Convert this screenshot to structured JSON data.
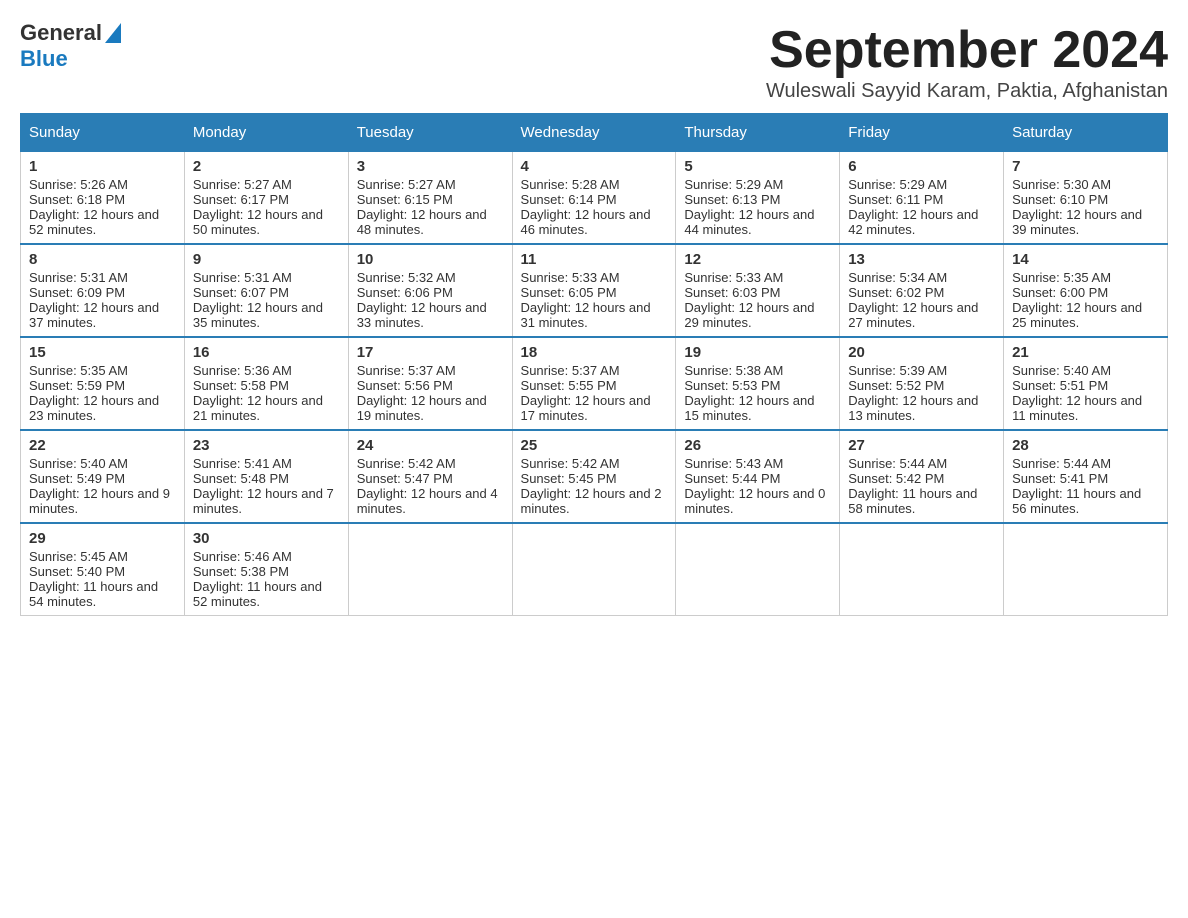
{
  "header": {
    "logo_general": "General",
    "logo_blue": "Blue",
    "month_title": "September 2024",
    "subtitle": "Wuleswali Sayyid Karam, Paktia, Afghanistan"
  },
  "days_of_week": [
    "Sunday",
    "Monday",
    "Tuesday",
    "Wednesday",
    "Thursday",
    "Friday",
    "Saturday"
  ],
  "weeks": [
    [
      {
        "day": "1",
        "sunrise": "Sunrise: 5:26 AM",
        "sunset": "Sunset: 6:18 PM",
        "daylight": "Daylight: 12 hours and 52 minutes."
      },
      {
        "day": "2",
        "sunrise": "Sunrise: 5:27 AM",
        "sunset": "Sunset: 6:17 PM",
        "daylight": "Daylight: 12 hours and 50 minutes."
      },
      {
        "day": "3",
        "sunrise": "Sunrise: 5:27 AM",
        "sunset": "Sunset: 6:15 PM",
        "daylight": "Daylight: 12 hours and 48 minutes."
      },
      {
        "day": "4",
        "sunrise": "Sunrise: 5:28 AM",
        "sunset": "Sunset: 6:14 PM",
        "daylight": "Daylight: 12 hours and 46 minutes."
      },
      {
        "day": "5",
        "sunrise": "Sunrise: 5:29 AM",
        "sunset": "Sunset: 6:13 PM",
        "daylight": "Daylight: 12 hours and 44 minutes."
      },
      {
        "day": "6",
        "sunrise": "Sunrise: 5:29 AM",
        "sunset": "Sunset: 6:11 PM",
        "daylight": "Daylight: 12 hours and 42 minutes."
      },
      {
        "day": "7",
        "sunrise": "Sunrise: 5:30 AM",
        "sunset": "Sunset: 6:10 PM",
        "daylight": "Daylight: 12 hours and 39 minutes."
      }
    ],
    [
      {
        "day": "8",
        "sunrise": "Sunrise: 5:31 AM",
        "sunset": "Sunset: 6:09 PM",
        "daylight": "Daylight: 12 hours and 37 minutes."
      },
      {
        "day": "9",
        "sunrise": "Sunrise: 5:31 AM",
        "sunset": "Sunset: 6:07 PM",
        "daylight": "Daylight: 12 hours and 35 minutes."
      },
      {
        "day": "10",
        "sunrise": "Sunrise: 5:32 AM",
        "sunset": "Sunset: 6:06 PM",
        "daylight": "Daylight: 12 hours and 33 minutes."
      },
      {
        "day": "11",
        "sunrise": "Sunrise: 5:33 AM",
        "sunset": "Sunset: 6:05 PM",
        "daylight": "Daylight: 12 hours and 31 minutes."
      },
      {
        "day": "12",
        "sunrise": "Sunrise: 5:33 AM",
        "sunset": "Sunset: 6:03 PM",
        "daylight": "Daylight: 12 hours and 29 minutes."
      },
      {
        "day": "13",
        "sunrise": "Sunrise: 5:34 AM",
        "sunset": "Sunset: 6:02 PM",
        "daylight": "Daylight: 12 hours and 27 minutes."
      },
      {
        "day": "14",
        "sunrise": "Sunrise: 5:35 AM",
        "sunset": "Sunset: 6:00 PM",
        "daylight": "Daylight: 12 hours and 25 minutes."
      }
    ],
    [
      {
        "day": "15",
        "sunrise": "Sunrise: 5:35 AM",
        "sunset": "Sunset: 5:59 PM",
        "daylight": "Daylight: 12 hours and 23 minutes."
      },
      {
        "day": "16",
        "sunrise": "Sunrise: 5:36 AM",
        "sunset": "Sunset: 5:58 PM",
        "daylight": "Daylight: 12 hours and 21 minutes."
      },
      {
        "day": "17",
        "sunrise": "Sunrise: 5:37 AM",
        "sunset": "Sunset: 5:56 PM",
        "daylight": "Daylight: 12 hours and 19 minutes."
      },
      {
        "day": "18",
        "sunrise": "Sunrise: 5:37 AM",
        "sunset": "Sunset: 5:55 PM",
        "daylight": "Daylight: 12 hours and 17 minutes."
      },
      {
        "day": "19",
        "sunrise": "Sunrise: 5:38 AM",
        "sunset": "Sunset: 5:53 PM",
        "daylight": "Daylight: 12 hours and 15 minutes."
      },
      {
        "day": "20",
        "sunrise": "Sunrise: 5:39 AM",
        "sunset": "Sunset: 5:52 PM",
        "daylight": "Daylight: 12 hours and 13 minutes."
      },
      {
        "day": "21",
        "sunrise": "Sunrise: 5:40 AM",
        "sunset": "Sunset: 5:51 PM",
        "daylight": "Daylight: 12 hours and 11 minutes."
      }
    ],
    [
      {
        "day": "22",
        "sunrise": "Sunrise: 5:40 AM",
        "sunset": "Sunset: 5:49 PM",
        "daylight": "Daylight: 12 hours and 9 minutes."
      },
      {
        "day": "23",
        "sunrise": "Sunrise: 5:41 AM",
        "sunset": "Sunset: 5:48 PM",
        "daylight": "Daylight: 12 hours and 7 minutes."
      },
      {
        "day": "24",
        "sunrise": "Sunrise: 5:42 AM",
        "sunset": "Sunset: 5:47 PM",
        "daylight": "Daylight: 12 hours and 4 minutes."
      },
      {
        "day": "25",
        "sunrise": "Sunrise: 5:42 AM",
        "sunset": "Sunset: 5:45 PM",
        "daylight": "Daylight: 12 hours and 2 minutes."
      },
      {
        "day": "26",
        "sunrise": "Sunrise: 5:43 AM",
        "sunset": "Sunset: 5:44 PM",
        "daylight": "Daylight: 12 hours and 0 minutes."
      },
      {
        "day": "27",
        "sunrise": "Sunrise: 5:44 AM",
        "sunset": "Sunset: 5:42 PM",
        "daylight": "Daylight: 11 hours and 58 minutes."
      },
      {
        "day": "28",
        "sunrise": "Sunrise: 5:44 AM",
        "sunset": "Sunset: 5:41 PM",
        "daylight": "Daylight: 11 hours and 56 minutes."
      }
    ],
    [
      {
        "day": "29",
        "sunrise": "Sunrise: 5:45 AM",
        "sunset": "Sunset: 5:40 PM",
        "daylight": "Daylight: 11 hours and 54 minutes."
      },
      {
        "day": "30",
        "sunrise": "Sunrise: 5:46 AM",
        "sunset": "Sunset: 5:38 PM",
        "daylight": "Daylight: 11 hours and 52 minutes."
      },
      null,
      null,
      null,
      null,
      null
    ]
  ]
}
